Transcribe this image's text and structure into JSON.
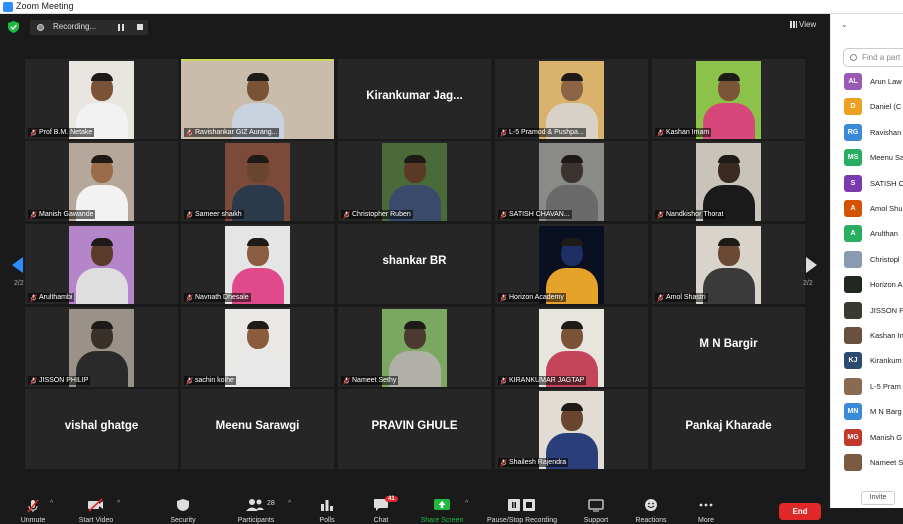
{
  "window": {
    "title": "Zoom Meeting"
  },
  "topbar": {
    "recording_label": "Recording...",
    "view_label": "View"
  },
  "gallery": {
    "page_indicator_left": "2/2",
    "page_indicator_right": "2/2",
    "tiles": [
      {
        "label": "Prof B.M. Netake",
        "type": "video",
        "bg": "#e9e6e2",
        "skin": "#7a5238",
        "shirt": "#f2f2f2"
      },
      {
        "label": "Ravishankar  GIZ Aurang...",
        "type": "video",
        "active": true,
        "bg": "#c9bcaa",
        "skin": "#7a5236",
        "shirt": "#c9d3e0"
      },
      {
        "label": "",
        "type": "name",
        "name": "Kirankumar  Jag..."
      },
      {
        "label": "L-5 Pramod & Pushpa...",
        "type": "video",
        "bg": "#d9b26c",
        "skin": "#8a6444",
        "shirt": "#d8d2c8"
      },
      {
        "label": "Kashan Imam",
        "type": "video",
        "bg": "#8cc24a",
        "skin": "#7b5538",
        "shirt": "#d7487a"
      },
      {
        "label": "Manish Gawande",
        "type": "video",
        "bg": "#b5a89a",
        "skin": "#9a6c4a",
        "shirt": "#f2f2f2"
      },
      {
        "label": "Sameer shaikh",
        "type": "video",
        "bg": "#7c4a3a",
        "skin": "#6a4630",
        "shirt": "#2b3a4a"
      },
      {
        "label": "Christopher Ruben",
        "type": "video",
        "bg": "#4a6a3a",
        "skin": "#5a3a24",
        "shirt": "#3a4a6a"
      },
      {
        "label": "SATISH CHAVAN...",
        "type": "video",
        "bg": "#8a8a86",
        "skin": "#3a3330",
        "shirt": "#6a6a6a"
      },
      {
        "label": "Nandkishor Thorat",
        "type": "video",
        "bg": "#c8c4bc",
        "skin": "#3a2a20",
        "shirt": "#1a1a1a"
      },
      {
        "label": "Arulthambi",
        "type": "video",
        "bg": "#b585c9",
        "skin": "#5a3a28",
        "shirt": "#dedede"
      },
      {
        "label": "Navnath Dhesale",
        "type": "video",
        "bg": "#e5e5e5",
        "skin": "#8a5c40",
        "shirt": "#e04a8a"
      },
      {
        "label": "",
        "type": "name",
        "name": "shankar BR"
      },
      {
        "label": "Horizon Academy",
        "type": "video",
        "bg": "#0a1020",
        "skin": "#1e2f66",
        "shirt": "#e6a32a"
      },
      {
        "label": "Amol Shastri",
        "type": "video",
        "bg": "#d8d4cc",
        "skin": "#6a4a34",
        "shirt": "#3a3a3a"
      },
      {
        "label": "JISSON PHILIP",
        "type": "video",
        "bg": "#9a9288",
        "skin": "#3a302a",
        "shirt": "#2a2a2a"
      },
      {
        "label": "sachin kolhe",
        "type": "video",
        "bg": "#eae8e4",
        "skin": "#8a5c3c",
        "shirt": "#e8e8e8"
      },
      {
        "label": "Nameet Sethy",
        "type": "video",
        "bg": "#7aa860",
        "skin": "#4a3a30",
        "shirt": "#b0b0a8"
      },
      {
        "label": "KIRANKUMAR JAGTAP",
        "type": "video",
        "bg": "#e8e4de",
        "skin": "#7a5236",
        "shirt": "#c2455a"
      },
      {
        "label": "",
        "type": "name",
        "name": "M N Bargir"
      },
      {
        "label": "",
        "type": "name",
        "name": "vishal ghatge"
      },
      {
        "label": "",
        "type": "name",
        "name": "Meenu Sarawgi"
      },
      {
        "label": "",
        "type": "name",
        "name": "PRAVIN GHULE"
      },
      {
        "label": "Shailesh Rajendra",
        "type": "video",
        "bg": "#e2ddd4",
        "skin": "#6a4630",
        "shirt": "#2a3e7a"
      },
      {
        "label": "",
        "type": "name",
        "name": "Pankaj Kharade"
      }
    ]
  },
  "toolbar": {
    "unmute": "Unmute",
    "start_video": "Start Video",
    "security": "Security",
    "participants": "Participants",
    "participants_count": "28",
    "polls": "Polls",
    "chat": "Chat",
    "chat_badge": "41",
    "share_screen": "Share Screen",
    "recording": "Pause/Stop Recording",
    "support": "Support",
    "reactions": "Reactions",
    "more": "More",
    "end": "End"
  },
  "participants_panel": {
    "search_placeholder": "Find a part",
    "invite": "Invite",
    "items": [
      {
        "initials": "AL",
        "color": "#9b59b6",
        "name": "Arun Law"
      },
      {
        "initials": "D",
        "color": "#f0a020",
        "name": "Daniel (C"
      },
      {
        "initials": "RG",
        "color": "#3a8ad8",
        "name": "Ravishan"
      },
      {
        "initials": "MS",
        "color": "#27ae60",
        "name": "Meenu Sa"
      },
      {
        "initials": "S",
        "color": "#7a3ab0",
        "name": "SATISH C"
      },
      {
        "initials": "A",
        "color": "#d35400",
        "name": "Amol Shu"
      },
      {
        "initials": "A",
        "color": "#27ae60",
        "name": "Arulthan"
      },
      {
        "initials": "",
        "color": "#8a9ab0",
        "name": "Christopl"
      },
      {
        "initials": "",
        "color": "#202820",
        "name": "Horizon A"
      },
      {
        "initials": "",
        "color": "#3a3a30",
        "name": "JISSON P"
      },
      {
        "initials": "",
        "color": "#6a5040",
        "name": "Kashan In"
      },
      {
        "initials": "KJ",
        "color": "#2c4a70",
        "name": "Kirankum"
      },
      {
        "initials": "",
        "color": "#8a6a50",
        "name": "L-5 Pram"
      },
      {
        "initials": "MN",
        "color": "#3a8ad8",
        "name": "M N Barg"
      },
      {
        "initials": "MG",
        "color": "#c0392b",
        "name": "Manish G"
      },
      {
        "initials": "",
        "color": "#7a5a40",
        "name": "Nameet S"
      }
    ]
  }
}
